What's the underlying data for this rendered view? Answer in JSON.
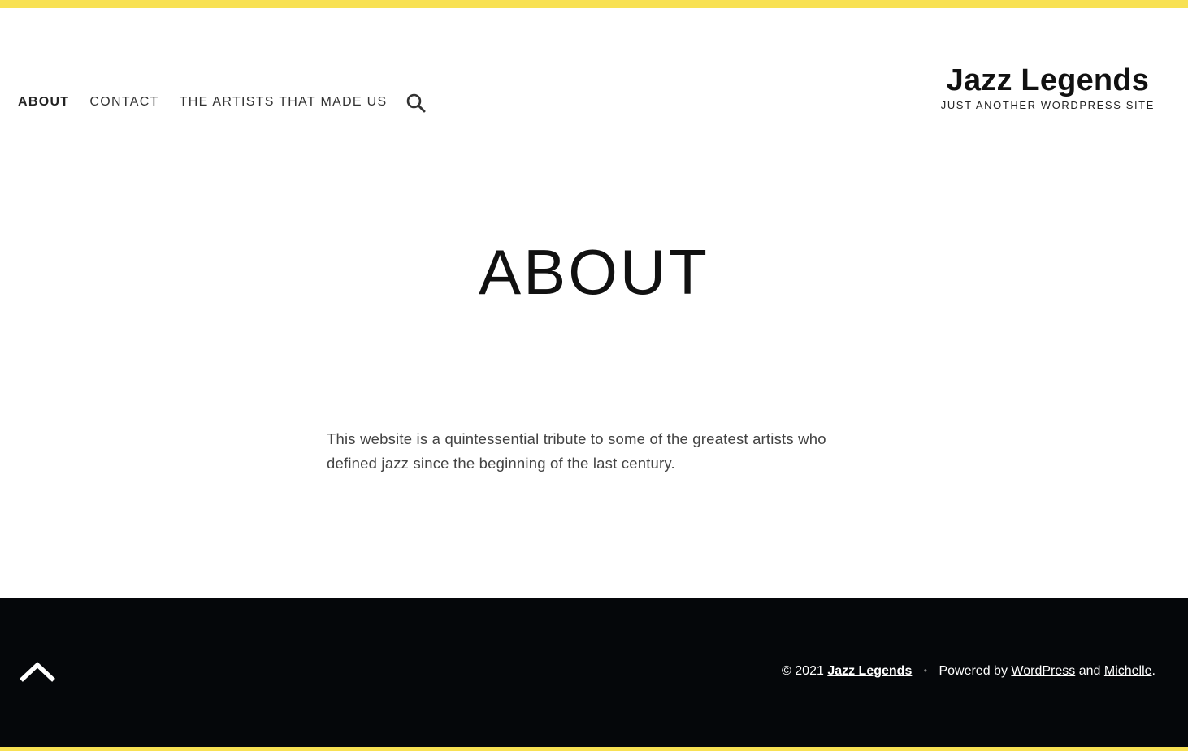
{
  "colors": {
    "accent": "#f8e153",
    "footer_bg": "#05070a",
    "text": "#111111"
  },
  "nav": {
    "items": [
      {
        "label": "ABOUT",
        "active": true
      },
      {
        "label": "CONTACT"
      },
      {
        "label": "THE ARTISTS THAT MADE US"
      }
    ],
    "search_icon": "search-icon"
  },
  "branding": {
    "title": "Jazz Legends",
    "tagline": "JUST ANOTHER WORDPRESS SITE"
  },
  "page": {
    "title": "ABOUT",
    "body": "This website is a quintessential tribute to some of the greatest artists who defined jazz since the beginning of the last century."
  },
  "footer": {
    "back_to_top_icon": "chevron-up-icon",
    "copyright": "© 2021",
    "site_link": "Jazz Legends",
    "separator": "•",
    "powered_by": "Powered by",
    "wordpress_link": "WordPress",
    "and_text": "and",
    "theme_link": "Michelle",
    "end_punct": "."
  }
}
